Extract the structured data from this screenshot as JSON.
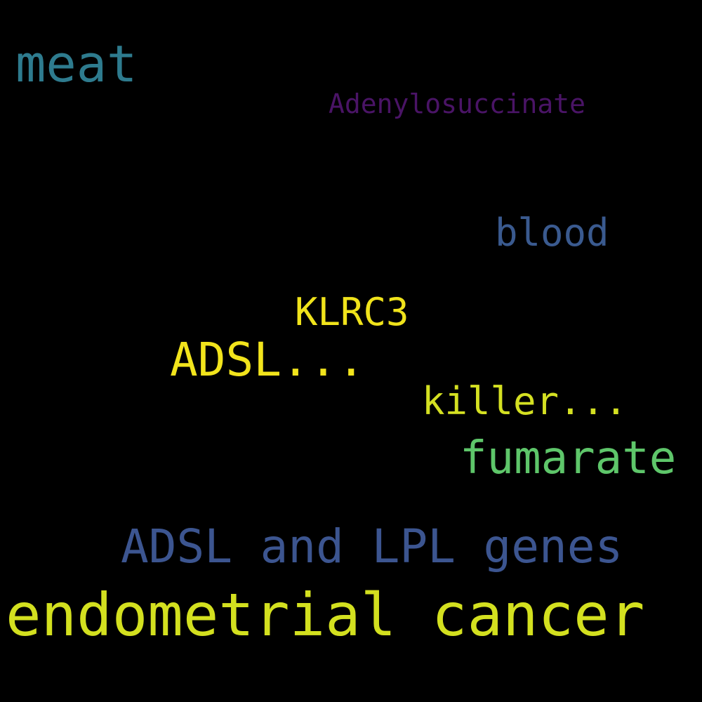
{
  "words": {
    "meat": {
      "text": "meat",
      "color": "#2e7b8e"
    },
    "adenylosuccinate": {
      "text": "Adenylosuccinate",
      "color": "#4a1466"
    },
    "blood": {
      "text": "blood",
      "color": "#3a5a8f"
    },
    "klrc3": {
      "text": "KLRC3",
      "color": "#f0e31b"
    },
    "adsl_ellipsis": {
      "text": "ADSL...",
      "color": "#f2e41c"
    },
    "killer_ellipsis": {
      "text": "killer...",
      "color": "#d4e022"
    },
    "fumarate": {
      "text": "fumarate",
      "color": "#5ec66a"
    },
    "adsl_lpl_genes": {
      "text": "ADSL and LPL genes",
      "color": "#3c5590"
    },
    "endometrial_cancer": {
      "text": "endometrial cancer",
      "color": "#d3e01f"
    }
  }
}
